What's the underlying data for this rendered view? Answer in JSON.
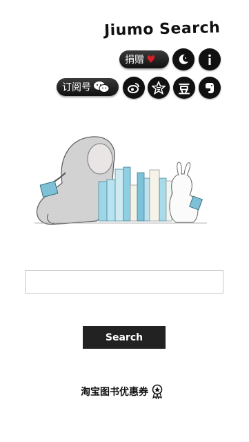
{
  "header": {
    "title": "Jiumo Search"
  },
  "toolbar": {
    "donate_label": "捐赠",
    "subscribe_label": "订阅号",
    "douban_label": "豆"
  },
  "icons": {
    "heart": "heart-icon",
    "moon": "moon-icon",
    "info": "info-icon",
    "wechat": "wechat-icon",
    "weibo": "weibo-icon",
    "star": "star-icon",
    "douban": "douban-icon",
    "evernote": "evernote-icon",
    "award": "award-icon"
  },
  "search": {
    "placeholder": "",
    "value": "",
    "button_label": "Search"
  },
  "footer": {
    "coupon_label": "淘宝图书优惠券"
  },
  "colors": {
    "dark": "#111111",
    "heart": "#d61f26",
    "book_blue": "#8fd0e4"
  }
}
